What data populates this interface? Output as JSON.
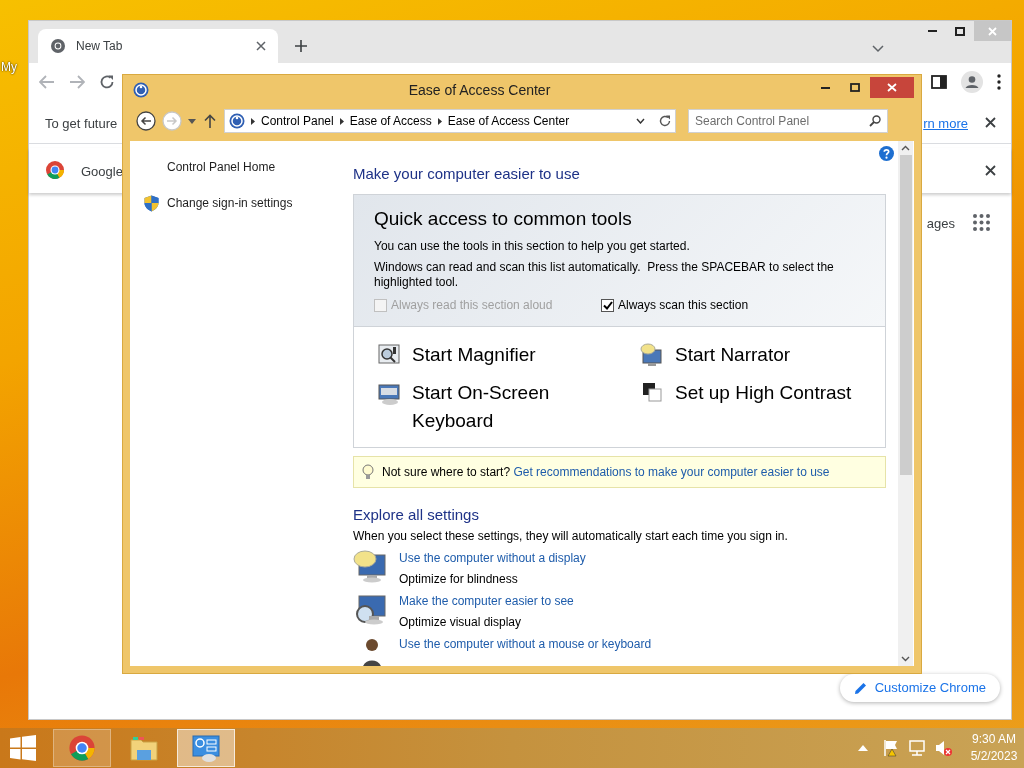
{
  "desktop": {
    "icons": [
      {
        "label": "My"
      }
    ]
  },
  "browser": {
    "tabs": [
      {
        "label": "New Tab",
        "selected": true
      }
    ],
    "infobar": {
      "text": "To get future",
      "link": "rn more"
    },
    "notice": {
      "text": "Google"
    },
    "new_tab_page": {
      "shortcut_label": "ages",
      "customize_button": "Customize Chrome"
    }
  },
  "dialog": {
    "title": "Ease of Access Center",
    "breadcrumb": [
      "Control Panel",
      "Ease of Access",
      "Ease of Access Center"
    ],
    "search": {
      "placeholder": "Search Control Panel"
    },
    "sidebar": [
      {
        "label": "Control Panel Home",
        "kind": "plain"
      },
      {
        "label": "Change sign-in settings",
        "kind": "shield"
      }
    ],
    "heading": "Make your computer easier to use",
    "quick_access": {
      "title": "Quick access to common tools",
      "paragraphs": [
        "You can use the tools in this section to help you get started.",
        "Windows can read and scan this list automatically.  Press the SPACEBAR to select the highlighted tool."
      ],
      "options": [
        {
          "label": "Always read this section aloud",
          "checked": false,
          "disabled": true
        },
        {
          "label": "Always scan this section",
          "checked": true,
          "disabled": false
        }
      ],
      "tools": [
        {
          "label": "Start Magnifier",
          "kind": "magnifier"
        },
        {
          "label": "Start Narrator",
          "kind": "narrator"
        },
        {
          "label": "Start On-Screen Keyboard",
          "kind": "keyboard"
        },
        {
          "label": "Set up High Contrast",
          "kind": "contrast"
        }
      ]
    },
    "tip": {
      "text": "Not sure where to start?",
      "link": "Get recommendations to make your computer easier to use"
    },
    "explore": {
      "title": "Explore all settings",
      "description": "When you select these settings, they will automatically start each time you sign in.",
      "items": [
        {
          "link": "Use the computer without a display",
          "description": "Optimize for blindness",
          "kind": "display"
        },
        {
          "link": "Make the computer easier to see",
          "description": "Optimize visual display",
          "kind": "see"
        },
        {
          "link": "Use the computer without a mouse or keyboard",
          "kind": "person"
        }
      ]
    }
  },
  "taskbar": {
    "apps": [
      {
        "kind": "chrome",
        "running": true,
        "selected": false
      },
      {
        "kind": "explorer",
        "running": false,
        "selected": false
      },
      {
        "kind": "control_panel",
        "running": true,
        "selected": true
      }
    ],
    "clock": {
      "time": "9:30 AM",
      "date": "5/2/2023"
    }
  }
}
